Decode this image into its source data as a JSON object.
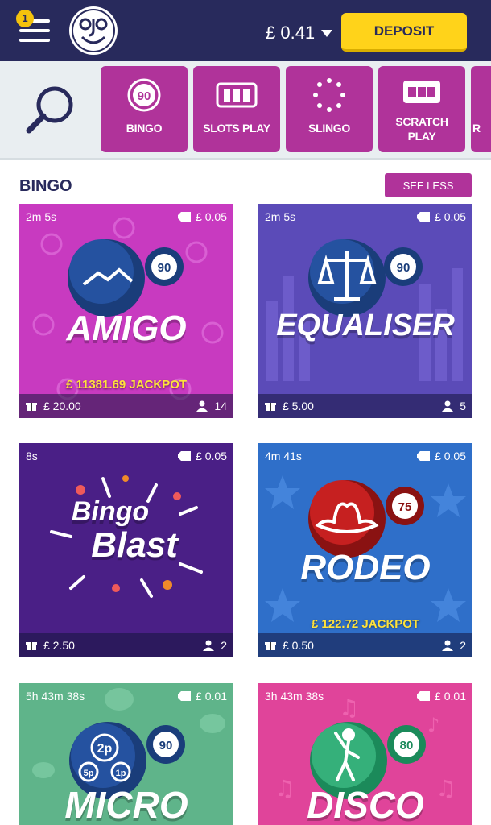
{
  "header": {
    "notification_count": "1",
    "balance": "£ 0.41",
    "deposit_label": "DEPOSIT"
  },
  "categories": [
    {
      "label": "BINGO",
      "icon": "bingo-ball-icon",
      "icon_text": "90"
    },
    {
      "label": "SLOTS PLAY",
      "icon": "slot-reels-icon"
    },
    {
      "label": "SLINGO",
      "icon": "slingo-ring-icon"
    },
    {
      "label": "SCRATCH PLAY",
      "icon": "scratch-card-icon"
    },
    {
      "label": "R",
      "icon": "partial-category-icon"
    }
  ],
  "section": {
    "title": "BINGO",
    "toggle_label": "SEE LESS"
  },
  "games": [
    {
      "name": "AMIGO",
      "timer": "2m 5s",
      "ticket_price": "£ 0.05",
      "ball": "90",
      "jackpot": "£ 11381.69 JACKPOT",
      "prize": "£ 20.00",
      "players": "14",
      "colors": {
        "bg": "#c83ac0",
        "accent": "#e04ed8"
      }
    },
    {
      "name": "EQUALISER",
      "timer": "2m 5s",
      "ticket_price": "£ 0.05",
      "ball": "90",
      "jackpot": "",
      "prize": "£ 5.00",
      "players": "5",
      "colors": {
        "bg": "#5b4bb8",
        "accent": "#7a68d6"
      }
    },
    {
      "name_line1": "Bingo",
      "name_line2": "Blast",
      "timer": "8s",
      "ticket_price": "£ 0.05",
      "ball": "",
      "jackpot": "",
      "prize": "£ 2.50",
      "players": "2",
      "colors": {
        "bg": "#4a1f86",
        "accent": "#6a2fb0"
      }
    },
    {
      "name": "RODEO",
      "timer": "4m 41s",
      "ticket_price": "£ 0.05",
      "ball": "75",
      "jackpot": "£ 122.72 JACKPOT",
      "prize": "£ 0.50",
      "players": "2",
      "colors": {
        "bg": "#2f6fc9",
        "accent": "#4a8ae0"
      }
    },
    {
      "name": "MICRO",
      "timer": "5h 43m 38s",
      "ticket_price": "£ 0.01",
      "ball": "90",
      "coin_labels": [
        "2p",
        "5p",
        "1p"
      ],
      "jackpot": "",
      "colors": {
        "bg": "#5fb48a",
        "accent": "#7ccaa2"
      }
    },
    {
      "name": "DISCO",
      "timer": "3h 43m 38s",
      "ticket_price": "£ 0.01",
      "ball": "80",
      "jackpot": "",
      "colors": {
        "bg": "#e0449a",
        "accent": "#f066b2"
      }
    }
  ]
}
